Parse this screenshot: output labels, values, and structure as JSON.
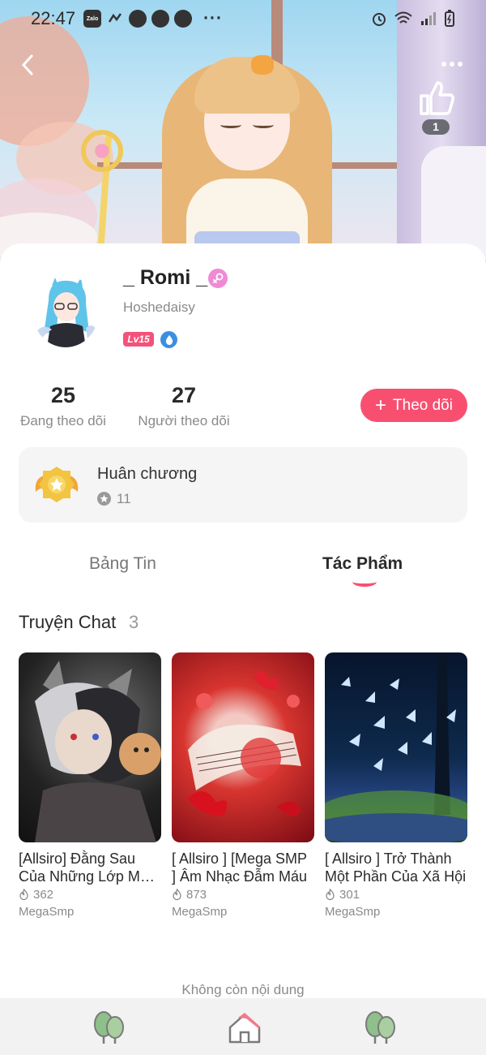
{
  "status_bar": {
    "time": "22:47",
    "notification_icons": [
      "zalo-icon",
      "activity-icon",
      "messenger-icon",
      "messenger-icon",
      "messenger-icon"
    ],
    "more": "···",
    "system_icons": [
      "alarm-icon",
      "wifi-icon",
      "signal-icon",
      "battery-icon"
    ]
  },
  "header": {
    "like_count": "1"
  },
  "profile": {
    "display_name": "_ Romi _",
    "username": "Hoshedaisy",
    "level": "Lv15",
    "gender": "female"
  },
  "stats": {
    "following_count": "25",
    "following_label": "Đang theo dõi",
    "followers_count": "27",
    "followers_label": "Người theo dõi"
  },
  "follow_button": {
    "label": "Theo dõi"
  },
  "medals": {
    "title": "Huân chương",
    "count": "11"
  },
  "tabs": [
    {
      "label": "Bảng Tin",
      "active": false
    },
    {
      "label": "Tác Phẩm",
      "active": true
    }
  ],
  "section": {
    "title": "Truyện Chat",
    "count": "3"
  },
  "stories": [
    {
      "title": "[Allsiro] Đằng Sau Của Những Lớp Mặt Nạ",
      "views": "362",
      "author": "MegaSmp"
    },
    {
      "title": "[ Allsiro ] [Mega SMP ] Âm Nhạc Đẫm Máu",
      "views": "873",
      "author": "MegaSmp"
    },
    {
      "title": "[ Allsiro ] Trở Thành Một Phần Của Xã Hội",
      "views": "301",
      "author": "MegaSmp"
    }
  ],
  "footer_note": "Không còn nội dung",
  "bottom_nav": [
    "tree-icon",
    "home-icon",
    "tree-icon"
  ],
  "colors": {
    "accent": "#f84f71",
    "level_badge": "#f4527a",
    "gender_badge": "#f08ad6",
    "medal_gold": "#f2c440"
  }
}
